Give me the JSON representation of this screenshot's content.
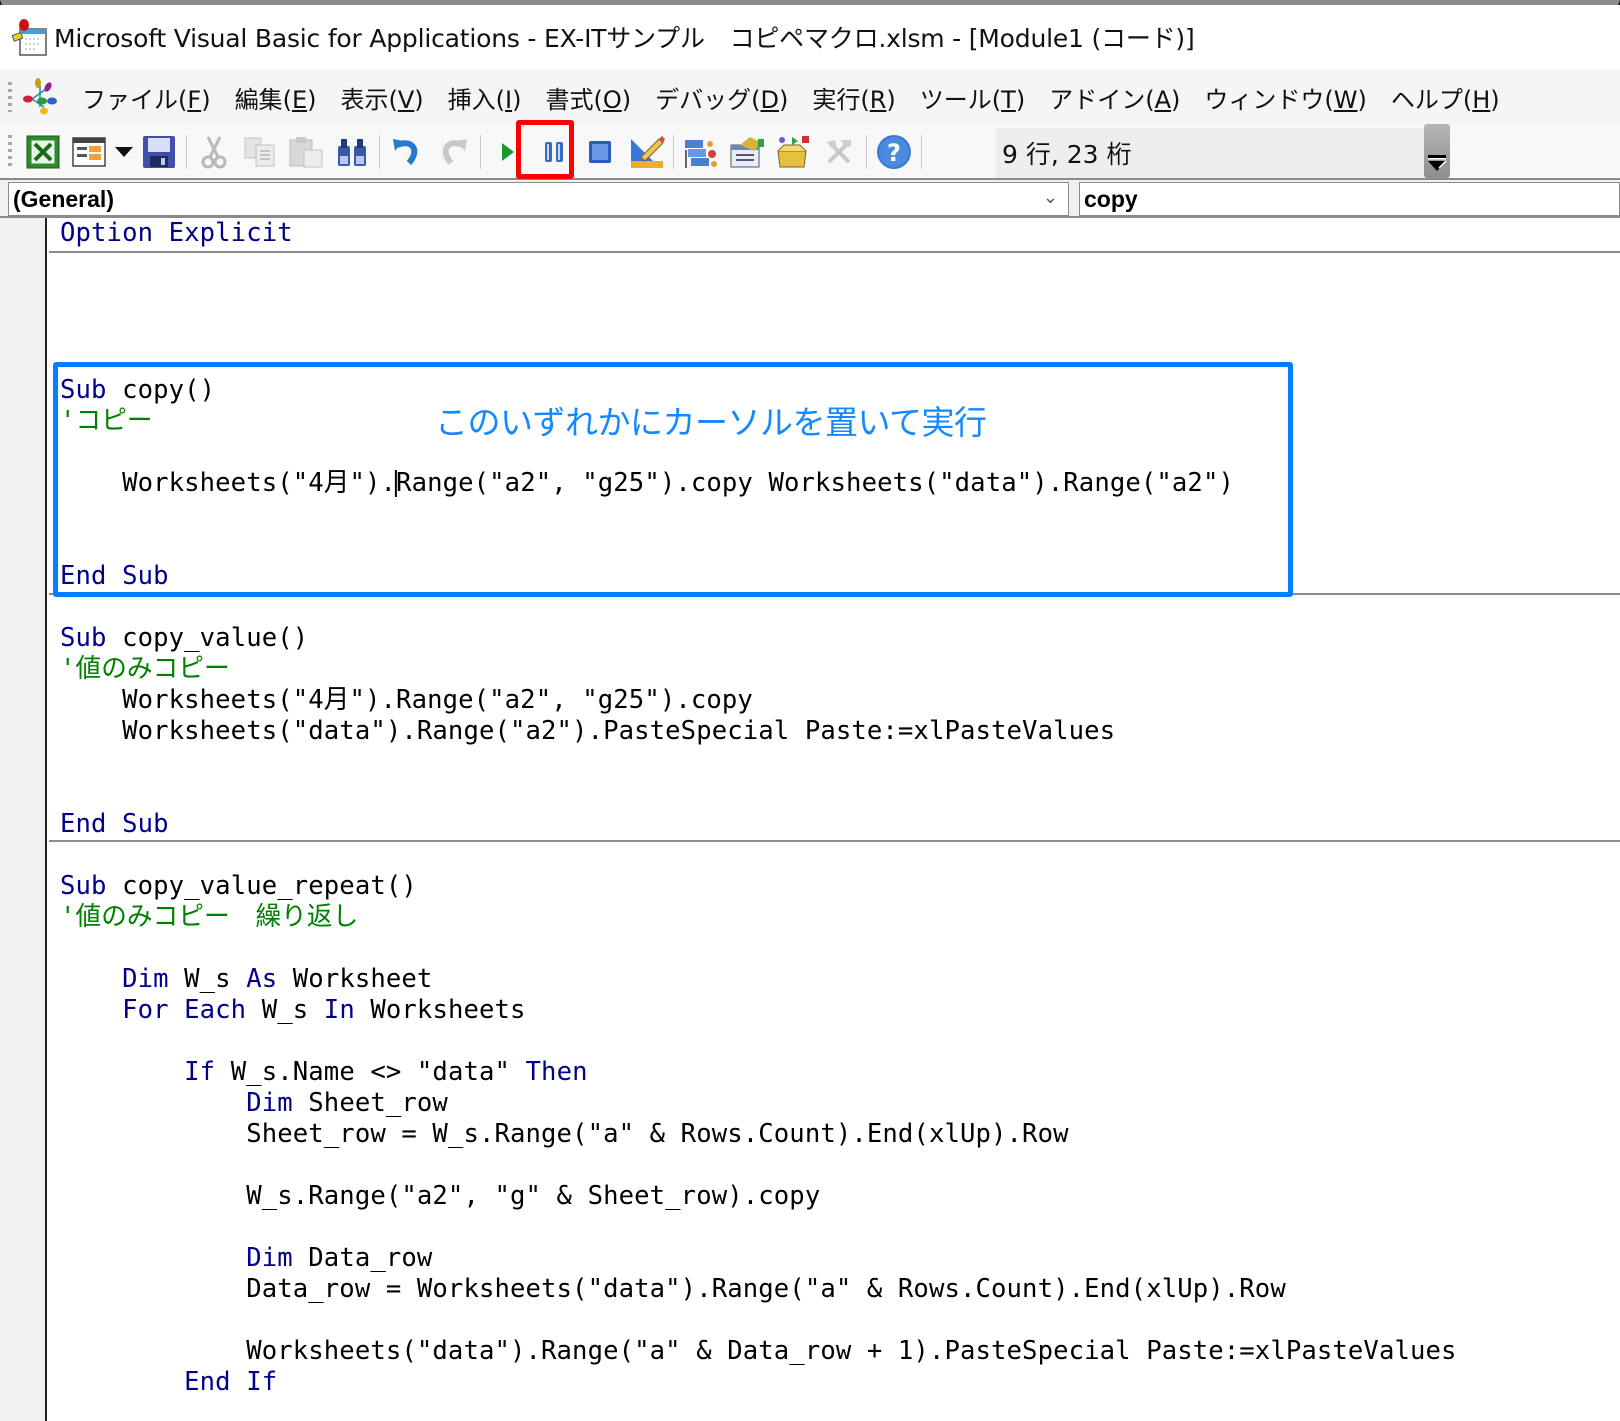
{
  "window": {
    "title": "Microsoft Visual Basic for Applications - EX-ITサンプル　コピペマクロ.xlsm - [Module1 (コード)]"
  },
  "menu": {
    "items": [
      {
        "label": "ファイル",
        "accel": "F"
      },
      {
        "label": "編集",
        "accel": "E"
      },
      {
        "label": "表示",
        "accel": "V"
      },
      {
        "label": "挿入",
        "accel": "I"
      },
      {
        "label": "書式",
        "accel": "O"
      },
      {
        "label": "デバッグ",
        "accel": "D"
      },
      {
        "label": "実行",
        "accel": "R"
      },
      {
        "label": "ツール",
        "accel": "T"
      },
      {
        "label": "アドイン",
        "accel": "A"
      },
      {
        "label": "ウィンドウ",
        "accel": "W"
      },
      {
        "label": "ヘルプ",
        "accel": "H"
      }
    ]
  },
  "toolbar": {
    "buttons": [
      {
        "icon": "excel-view-icon",
        "enabled": true
      },
      {
        "icon": "insert-userform-icon",
        "enabled": true
      },
      {
        "icon": "dropdown-arrow-icon",
        "enabled": true
      },
      {
        "icon": "save-icon",
        "enabled": true
      },
      {
        "icon": "cut-icon",
        "enabled": false
      },
      {
        "icon": "copy-icon",
        "enabled": false
      },
      {
        "icon": "paste-icon",
        "enabled": false
      },
      {
        "icon": "find-icon",
        "enabled": true
      },
      {
        "icon": "undo-icon",
        "enabled": true
      },
      {
        "icon": "redo-icon",
        "enabled": false
      },
      {
        "icon": "run-icon",
        "enabled": true,
        "highlighted": true
      },
      {
        "icon": "break-icon",
        "enabled": true
      },
      {
        "icon": "reset-icon",
        "enabled": true
      },
      {
        "icon": "design-mode-icon",
        "enabled": true
      },
      {
        "icon": "project-explorer-icon",
        "enabled": true
      },
      {
        "icon": "properties-window-icon",
        "enabled": true
      },
      {
        "icon": "object-browser-icon",
        "enabled": true
      },
      {
        "icon": "toolbox-icon",
        "enabled": false
      },
      {
        "icon": "help-icon",
        "enabled": true
      }
    ],
    "cursor_position": "9 行, 23 桁"
  },
  "combos": {
    "object": "(General)",
    "procedure": "copy"
  },
  "annotation": {
    "text": "このいずれかにカーソルを置いて実行",
    "color": "#1488ff",
    "box_color": "#0080ff",
    "run_highlight_color": "#ff0000"
  },
  "code": {
    "option": "Option Explicit",
    "proc1": {
      "sub_kw": "Sub",
      "name": " copy()",
      "comment": "'コピー",
      "line_a": "    Worksheets(\"4月\").",
      "line_b": "Range(\"a2\", \"g25\").copy Worksheets(\"data\").Range(\"a2\")",
      "end": "End Sub"
    },
    "proc2": {
      "sub_kw": "Sub",
      "name": " copy_value()",
      "comment": "'値のみコピー",
      "line1": "    Worksheets(\"4月\").Range(\"a2\", \"g25\").copy",
      "line2": "    Worksheets(\"data\").Range(\"a2\").PasteSpecial Paste:=xlPasteValues",
      "end": "End Sub"
    },
    "proc3": {
      "sub_kw": "Sub",
      "name": " copy_value_repeat()",
      "comment": "'値のみコピー　繰り返し",
      "dim_kw": "    Dim",
      "dim_rest_1": " W_s ",
      "as_kw": "As",
      "dim_rest_2": " Worksheet",
      "for_kw": "    For Each",
      "for_rest_1": " W_s ",
      "in_kw": "In",
      "for_rest_2": " Worksheets",
      "if_kw": "        If",
      "if_rest": " W_s.Name <> \"data\" ",
      "then_kw": "Then",
      "dim2_kw": "            Dim",
      "dim2_rest": " Sheet_row",
      "sheet_row_line": "            Sheet_row = W_s.Range(\"a\" & Rows.Count).End(xlUp).Row",
      "copy_line": "            W_s.Range(\"a2\", \"g\" & Sheet_row).copy",
      "dim3_kw": "            Dim",
      "dim3_rest": " Data_row",
      "data_row_line": "            Data_row = Worksheets(\"data\").Range(\"a\" & Rows.Count).End(xlUp).Row",
      "paste_line": "            Worksheets(\"data\").Range(\"a\" & Data_row + 1).PasteSpecial Paste:=xlPasteValues",
      "endif_kw": "        End If"
    }
  }
}
